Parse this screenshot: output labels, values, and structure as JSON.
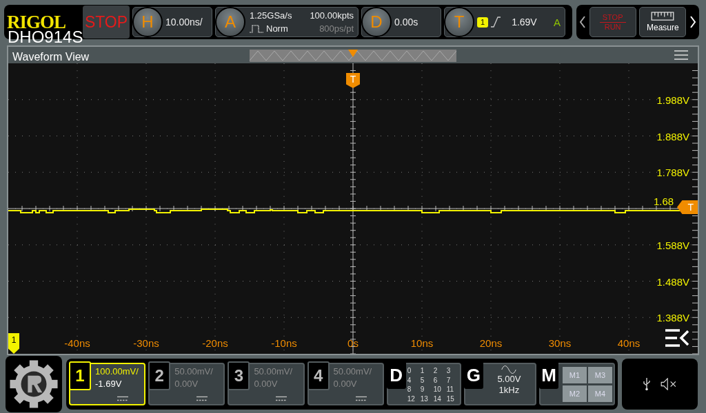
{
  "brand": {
    "logo": "RIGOL",
    "model": "DHO914S"
  },
  "run_state": "STOP",
  "horizontal": {
    "key": "H",
    "scale": "10.00ns/"
  },
  "acquire": {
    "key": "A",
    "sample_rate": "1.25GSa/s",
    "mode": "Norm",
    "memory_depth": "100.00kpts",
    "sample_interval": "800ps/pt"
  },
  "delay": {
    "key": "D",
    "value": "0.00s"
  },
  "trigger": {
    "key": "T",
    "source": "1",
    "level": "1.69V",
    "sweep": "A"
  },
  "toolbar": {
    "stop_run": [
      "STOP",
      "RUN"
    ],
    "measure": "Measure"
  },
  "waveform_view": {
    "title": "Waveform View",
    "trigger_position_marker": "T",
    "channel_marker": "1",
    "trigger_level_label": "1.68",
    "trigger_level_marker": "T",
    "voltage_labels": [
      "1.988V",
      "1.888V",
      "1.788V",
      "1.588V",
      "1.488V",
      "1.388V"
    ],
    "time_labels": [
      "-40ns",
      "-30ns",
      "-20ns",
      "-10ns",
      "0s",
      "10ns",
      "20ns",
      "30ns",
      "40ns"
    ]
  },
  "channels": [
    {
      "number": "1",
      "scale": "100.00mV/",
      "offset": "-1.69V",
      "selected": true
    },
    {
      "number": "2",
      "scale": "50.00mV/",
      "offset": "0.00V",
      "selected": false
    },
    {
      "number": "3",
      "scale": "50.00mV/",
      "offset": "0.00V",
      "selected": false
    },
    {
      "number": "4",
      "scale": "50.00mV/",
      "offset": "0.00V",
      "selected": false
    }
  ],
  "digital": {
    "key": "D",
    "bits": [
      "0",
      "1",
      "2",
      "3",
      "4",
      "5",
      "6",
      "7",
      "8",
      "9",
      "10",
      "11",
      "12",
      "13",
      "14",
      "15"
    ]
  },
  "generator": {
    "key": "G",
    "amplitude": "5.00V",
    "frequency": "1kHz"
  },
  "math": {
    "key": "M",
    "items": [
      "M1",
      "M3",
      "M2",
      "M4"
    ]
  }
}
